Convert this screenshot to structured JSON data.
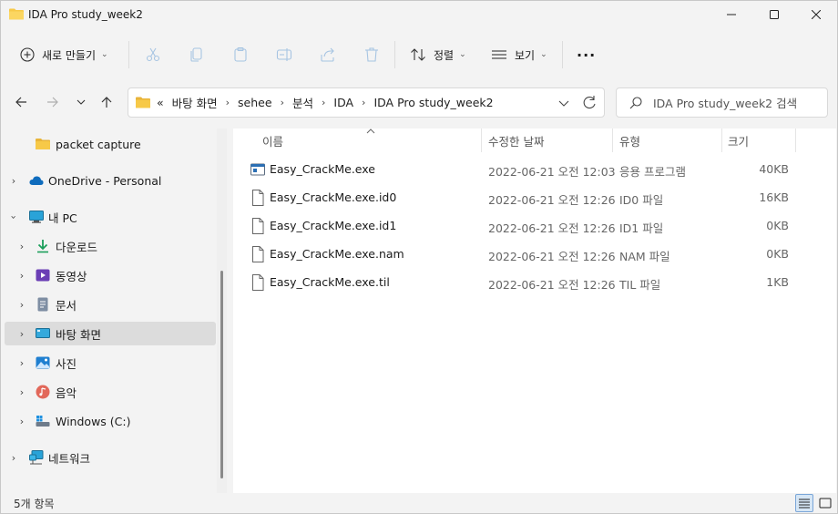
{
  "window": {
    "title": "IDA Pro study_week2"
  },
  "toolbar": {
    "new_label": "새로 만들기",
    "sort_label": "정렬",
    "view_label": "보기",
    "more_label": "···"
  },
  "address": {
    "overflow": "«",
    "breadcrumbs": [
      "바탕 화면",
      "sehee",
      "분석",
      "IDA",
      "IDA Pro study_week2"
    ]
  },
  "search": {
    "placeholder": "IDA Pro study_week2 검색"
  },
  "sidebar": {
    "items": [
      {
        "label": "packet capture",
        "icon": "folder-icon"
      },
      {
        "label": "OneDrive - Personal",
        "icon": "cloud-icon"
      },
      {
        "label": "내 PC",
        "icon": "pc-icon"
      },
      {
        "label": "다운로드",
        "icon": "download-icon"
      },
      {
        "label": "동영상",
        "icon": "video-icon"
      },
      {
        "label": "문서",
        "icon": "document-icon"
      },
      {
        "label": "바탕 화면",
        "icon": "desktop-icon"
      },
      {
        "label": "사진",
        "icon": "picture-icon"
      },
      {
        "label": "음악",
        "icon": "music-icon"
      },
      {
        "label": "Windows (C:)",
        "icon": "drive-icon"
      },
      {
        "label": "네트워크",
        "icon": "network-icon"
      }
    ]
  },
  "columns": {
    "name": "이름",
    "date": "수정한 날짜",
    "type": "유형",
    "size": "크기"
  },
  "files": [
    {
      "name": "Easy_CrackMe.exe",
      "date": "2022-06-21 오전 12:03",
      "type": "응용 프로그램",
      "size": "40KB",
      "icon": "exe-icon"
    },
    {
      "name": "Easy_CrackMe.exe.id0",
      "date": "2022-06-21 오전 12:26",
      "type": "ID0 파일",
      "size": "16KB",
      "icon": "file-icon"
    },
    {
      "name": "Easy_CrackMe.exe.id1",
      "date": "2022-06-21 오전 12:26",
      "type": "ID1 파일",
      "size": "0KB",
      "icon": "file-icon"
    },
    {
      "name": "Easy_CrackMe.exe.nam",
      "date": "2022-06-21 오전 12:26",
      "type": "NAM 파일",
      "size": "0KB",
      "icon": "file-icon"
    },
    {
      "name": "Easy_CrackMe.exe.til",
      "date": "2022-06-21 오전 12:26",
      "type": "TIL 파일",
      "size": "1KB",
      "icon": "file-icon"
    }
  ],
  "status": {
    "item_count": "5개 항목"
  },
  "colors": {
    "folder": "#f7c948",
    "accent": "#0067c0",
    "selected": "#dcdcdc"
  }
}
